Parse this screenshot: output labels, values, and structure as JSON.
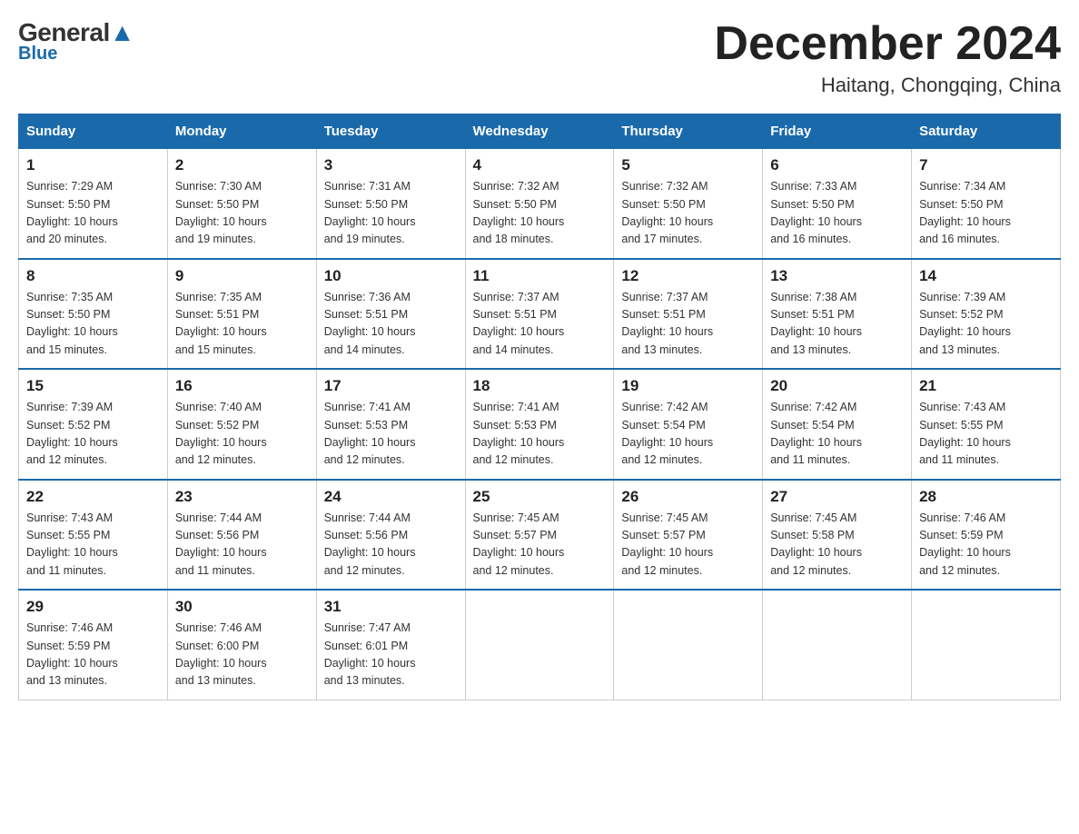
{
  "logo": {
    "general": "General",
    "triangle": "▲",
    "blue": "Blue"
  },
  "title": "December 2024",
  "subtitle": "Haitang, Chongqing, China",
  "days_of_week": [
    "Sunday",
    "Monday",
    "Tuesday",
    "Wednesday",
    "Thursday",
    "Friday",
    "Saturday"
  ],
  "weeks": [
    [
      {
        "day": "1",
        "sunrise": "7:29 AM",
        "sunset": "5:50 PM",
        "daylight": "10 hours and 20 minutes."
      },
      {
        "day": "2",
        "sunrise": "7:30 AM",
        "sunset": "5:50 PM",
        "daylight": "10 hours and 19 minutes."
      },
      {
        "day": "3",
        "sunrise": "7:31 AM",
        "sunset": "5:50 PM",
        "daylight": "10 hours and 19 minutes."
      },
      {
        "day": "4",
        "sunrise": "7:32 AM",
        "sunset": "5:50 PM",
        "daylight": "10 hours and 18 minutes."
      },
      {
        "day": "5",
        "sunrise": "7:32 AM",
        "sunset": "5:50 PM",
        "daylight": "10 hours and 17 minutes."
      },
      {
        "day": "6",
        "sunrise": "7:33 AM",
        "sunset": "5:50 PM",
        "daylight": "10 hours and 16 minutes."
      },
      {
        "day": "7",
        "sunrise": "7:34 AM",
        "sunset": "5:50 PM",
        "daylight": "10 hours and 16 minutes."
      }
    ],
    [
      {
        "day": "8",
        "sunrise": "7:35 AM",
        "sunset": "5:50 PM",
        "daylight": "10 hours and 15 minutes."
      },
      {
        "day": "9",
        "sunrise": "7:35 AM",
        "sunset": "5:51 PM",
        "daylight": "10 hours and 15 minutes."
      },
      {
        "day": "10",
        "sunrise": "7:36 AM",
        "sunset": "5:51 PM",
        "daylight": "10 hours and 14 minutes."
      },
      {
        "day": "11",
        "sunrise": "7:37 AM",
        "sunset": "5:51 PM",
        "daylight": "10 hours and 14 minutes."
      },
      {
        "day": "12",
        "sunrise": "7:37 AM",
        "sunset": "5:51 PM",
        "daylight": "10 hours and 13 minutes."
      },
      {
        "day": "13",
        "sunrise": "7:38 AM",
        "sunset": "5:51 PM",
        "daylight": "10 hours and 13 minutes."
      },
      {
        "day": "14",
        "sunrise": "7:39 AM",
        "sunset": "5:52 PM",
        "daylight": "10 hours and 13 minutes."
      }
    ],
    [
      {
        "day": "15",
        "sunrise": "7:39 AM",
        "sunset": "5:52 PM",
        "daylight": "10 hours and 12 minutes."
      },
      {
        "day": "16",
        "sunrise": "7:40 AM",
        "sunset": "5:52 PM",
        "daylight": "10 hours and 12 minutes."
      },
      {
        "day": "17",
        "sunrise": "7:41 AM",
        "sunset": "5:53 PM",
        "daylight": "10 hours and 12 minutes."
      },
      {
        "day": "18",
        "sunrise": "7:41 AM",
        "sunset": "5:53 PM",
        "daylight": "10 hours and 12 minutes."
      },
      {
        "day": "19",
        "sunrise": "7:42 AM",
        "sunset": "5:54 PM",
        "daylight": "10 hours and 12 minutes."
      },
      {
        "day": "20",
        "sunrise": "7:42 AM",
        "sunset": "5:54 PM",
        "daylight": "10 hours and 11 minutes."
      },
      {
        "day": "21",
        "sunrise": "7:43 AM",
        "sunset": "5:55 PM",
        "daylight": "10 hours and 11 minutes."
      }
    ],
    [
      {
        "day": "22",
        "sunrise": "7:43 AM",
        "sunset": "5:55 PM",
        "daylight": "10 hours and 11 minutes."
      },
      {
        "day": "23",
        "sunrise": "7:44 AM",
        "sunset": "5:56 PM",
        "daylight": "10 hours and 11 minutes."
      },
      {
        "day": "24",
        "sunrise": "7:44 AM",
        "sunset": "5:56 PM",
        "daylight": "10 hours and 12 minutes."
      },
      {
        "day": "25",
        "sunrise": "7:45 AM",
        "sunset": "5:57 PM",
        "daylight": "10 hours and 12 minutes."
      },
      {
        "day": "26",
        "sunrise": "7:45 AM",
        "sunset": "5:57 PM",
        "daylight": "10 hours and 12 minutes."
      },
      {
        "day": "27",
        "sunrise": "7:45 AM",
        "sunset": "5:58 PM",
        "daylight": "10 hours and 12 minutes."
      },
      {
        "day": "28",
        "sunrise": "7:46 AM",
        "sunset": "5:59 PM",
        "daylight": "10 hours and 12 minutes."
      }
    ],
    [
      {
        "day": "29",
        "sunrise": "7:46 AM",
        "sunset": "5:59 PM",
        "daylight": "10 hours and 13 minutes."
      },
      {
        "day": "30",
        "sunrise": "7:46 AM",
        "sunset": "6:00 PM",
        "daylight": "10 hours and 13 minutes."
      },
      {
        "day": "31",
        "sunrise": "7:47 AM",
        "sunset": "6:01 PM",
        "daylight": "10 hours and 13 minutes."
      },
      null,
      null,
      null,
      null
    ]
  ],
  "labels": {
    "sunrise": "Sunrise: ",
    "sunset": "Sunset: ",
    "daylight": "Daylight: "
  }
}
